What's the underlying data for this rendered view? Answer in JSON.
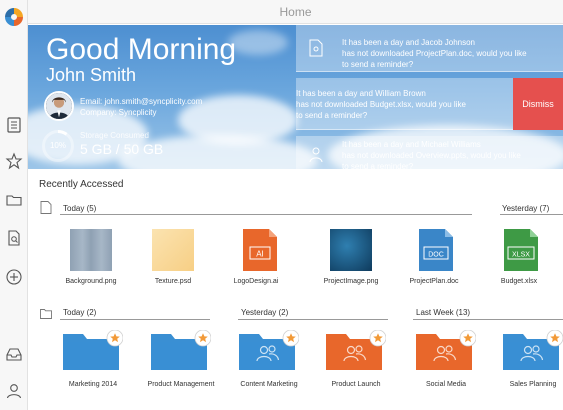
{
  "topbar": {
    "title": "Home"
  },
  "sidebar": {
    "icons": [
      "files-icon",
      "star-icon",
      "folder-icon",
      "document-search-icon",
      "add-icon",
      "inbox-icon",
      "user-icon"
    ]
  },
  "hero": {
    "greeting": "Good Morning",
    "user_name": "John Smith",
    "email": "Email: john.smith@syncplicity.com",
    "company": "Company: Syncplicity",
    "storage_percent": "10%",
    "storage_fraction": 0.1,
    "storage_label": "Storage Consumed",
    "storage_value": "5 GB / 50 GB"
  },
  "notifications": [
    {
      "line1": "It has been a day and Jacob Johnson",
      "line2": "has not downloaded ProjectPlan.doc, would you like",
      "line3": "to send a reminder?"
    },
    {
      "line1": "It has been a day and William Brown",
      "line2": "has not downloaded Budget.xlsx, would you like",
      "line3": "to send a reminder?"
    },
    {
      "line1": "It has been a day and Michael Williams",
      "line2": "has not downloaded Overview.ppts, would you like",
      "line3": "to send a reminder?"
    }
  ],
  "dismiss_label": "Dismiss",
  "recent": {
    "title": "Recently Accessed",
    "file_groups": [
      {
        "label": "Today (5)"
      },
      {
        "label": "Yesterday (7)"
      }
    ],
    "files": [
      {
        "name": "Background.png",
        "type": "image"
      },
      {
        "name": "Texture.psd",
        "type": "psd"
      },
      {
        "name": "LogoDesign.ai",
        "type": "ai",
        "badge": "AI",
        "color": "#e8672b"
      },
      {
        "name": "ProjectImage.png",
        "type": "image"
      },
      {
        "name": "ProjectPlan.doc",
        "type": "doc",
        "badge": "DOC",
        "color": "#3a86c8"
      },
      {
        "name": "Budget.xlsx",
        "type": "xlsx",
        "badge": "XLSX",
        "color": "#3e9a45"
      }
    ],
    "folder_groups": [
      {
        "label": "Today (2)"
      },
      {
        "label": "Yesterday (2)"
      },
      {
        "label": "Last Week (13)"
      }
    ],
    "folders": [
      {
        "name": "Marketing 2014",
        "color": "#3a8fd3",
        "shared": false
      },
      {
        "name": "Product Management",
        "color": "#3a8fd3",
        "shared": false
      },
      {
        "name": "Content Marketing",
        "color": "#3a8fd3",
        "shared": true
      },
      {
        "name": "Product Launch",
        "color": "#e8672b",
        "shared": true
      },
      {
        "name": "Social Media",
        "color": "#e8672b",
        "shared": true
      },
      {
        "name": "Sales Planning",
        "color": "#3a8fd3",
        "shared": true
      }
    ]
  }
}
